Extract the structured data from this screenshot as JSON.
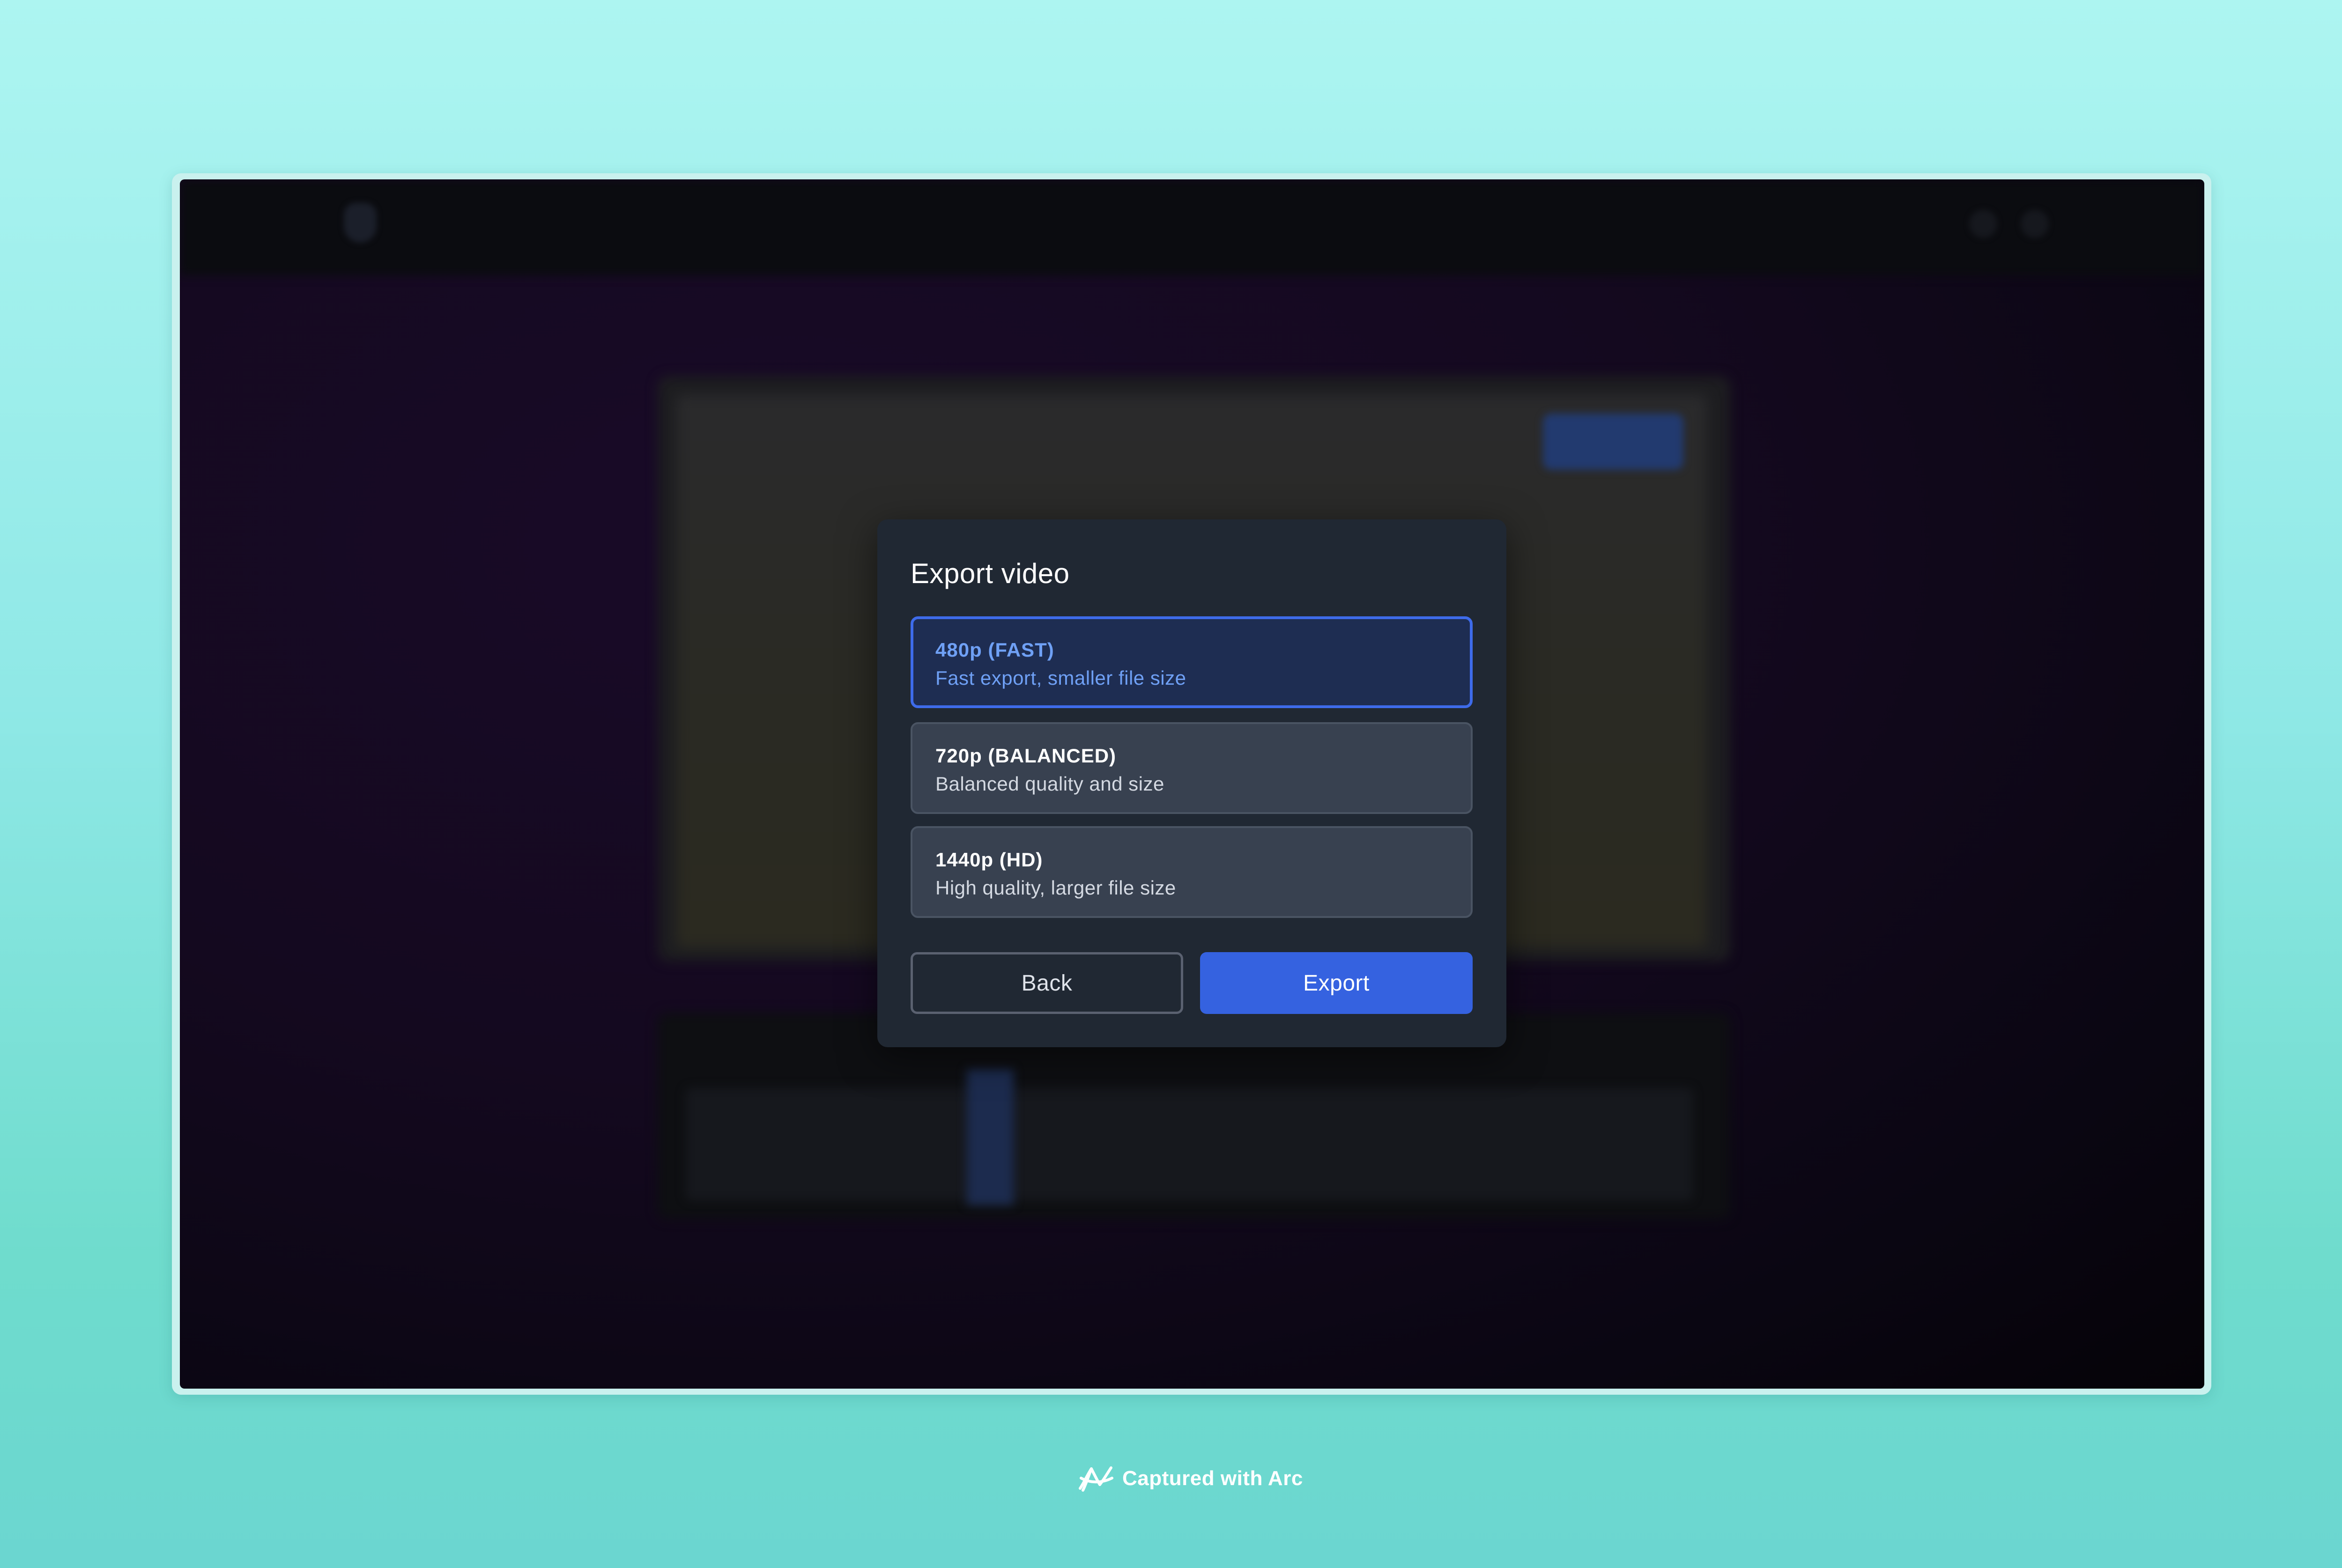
{
  "dialog": {
    "title": "Export video",
    "options": [
      {
        "title": "480p (FAST)",
        "description": "Fast export, smaller file size",
        "selected": true
      },
      {
        "title": "720p (BALANCED)",
        "description": "Balanced quality and size",
        "selected": false
      },
      {
        "title": "1440p (HD)",
        "description": "High quality, larger file size",
        "selected": false
      }
    ],
    "back_label": "Back",
    "export_label": "Export"
  },
  "footer": {
    "capture_text": "Captured with Arc",
    "icon": "arc-logo-icon"
  },
  "colors": {
    "accent": "#3562e0",
    "selected_border": "#3e6bea",
    "selected_text": "#6fa0f5",
    "dialog_bg": "#202833"
  }
}
